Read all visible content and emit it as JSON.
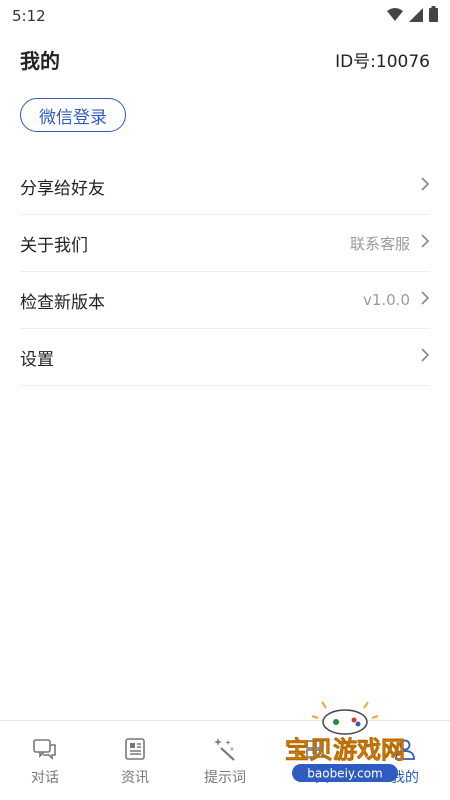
{
  "status_bar": {
    "time": "5:12"
  },
  "header": {
    "title": "我的",
    "user_id": "ID号:10076"
  },
  "login_button": {
    "label": "微信登录"
  },
  "menu": [
    {
      "label": "分享给好友",
      "value": ""
    },
    {
      "label": "关于我们",
      "value": "联系客服"
    },
    {
      "label": "检查新版本",
      "value": "v1.0.0"
    },
    {
      "label": "设置",
      "value": ""
    }
  ],
  "tabbar": {
    "tabs": [
      {
        "label": "对话",
        "icon": "chat-icon",
        "active": false
      },
      {
        "label": "资讯",
        "icon": "news-icon",
        "active": false
      },
      {
        "label": "提示词",
        "icon": "magic-wand-icon",
        "active": false
      },
      {
        "label": "工具",
        "icon": "tools-icon",
        "active": false
      },
      {
        "label": "我的",
        "icon": "profile-icon",
        "active": true
      }
    ]
  },
  "watermark": {
    "text": "宝贝游戏网",
    "url": "baobeiy.com"
  },
  "colors": {
    "accent": "#2f5cc0",
    "muted": "#9a9a9a",
    "watermark_orange": "#f5a623"
  }
}
